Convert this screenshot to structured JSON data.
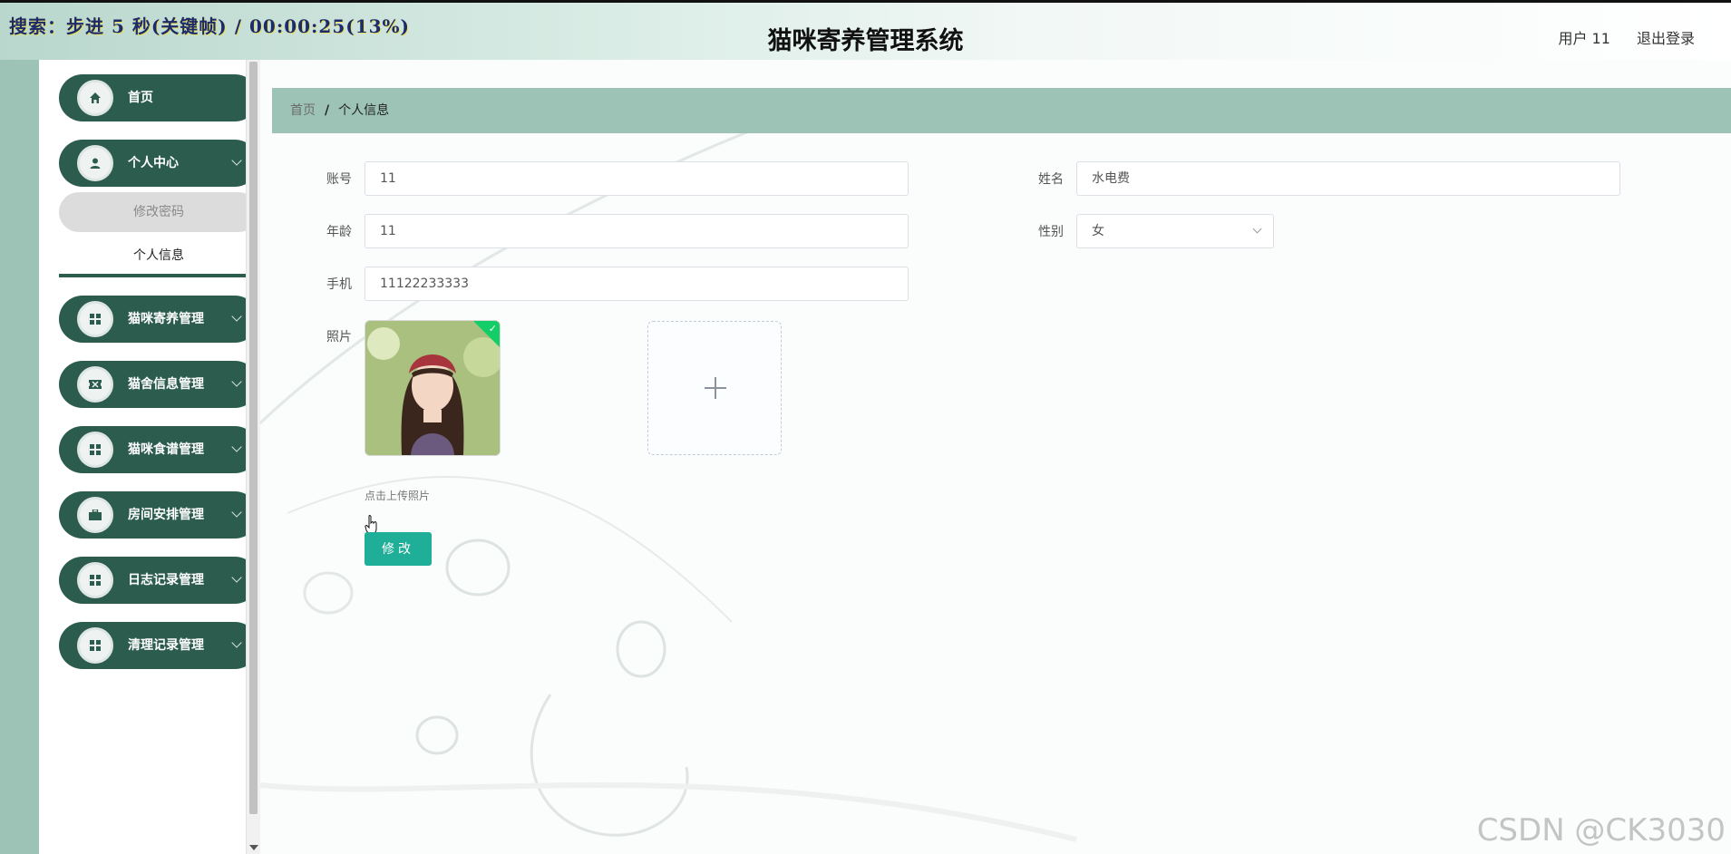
{
  "recording_overlay": "搜索：步进 5 秒(关键帧) / 00:00:25(13%)",
  "header": {
    "title": "猫咪寄养管理系统",
    "user_label": "用户 11",
    "logout_label": "退出登录"
  },
  "sidebar": {
    "items": [
      {
        "label": "首页",
        "icon": "home-icon"
      },
      {
        "label": "个人中心",
        "icon": "user-icon",
        "expanded": true,
        "children": [
          {
            "label": "修改密码",
            "active": false
          },
          {
            "label": "个人信息",
            "active": true
          }
        ]
      },
      {
        "label": "猫咪寄养管理",
        "icon": "grid-icon"
      },
      {
        "label": "猫舍信息管理",
        "icon": "ticket-icon"
      },
      {
        "label": "猫咪食谱管理",
        "icon": "grid-icon"
      },
      {
        "label": "房间安排管理",
        "icon": "briefcase-icon"
      },
      {
        "label": "日志记录管理",
        "icon": "grid-icon"
      },
      {
        "label": "清理记录管理",
        "icon": "grid-icon"
      }
    ]
  },
  "breadcrumb": {
    "home": "首页",
    "separator": "/",
    "current": "个人信息"
  },
  "form": {
    "account": {
      "label": "账号",
      "value": "11"
    },
    "name": {
      "label": "姓名",
      "value": "水电费"
    },
    "age": {
      "label": "年龄",
      "value": "11"
    },
    "gender": {
      "label": "性别",
      "value": "女"
    },
    "phone": {
      "label": "手机",
      "value": "11122233333"
    },
    "photo": {
      "label": "照片",
      "tip": "点击上传照片"
    },
    "submit_label": "修改"
  },
  "watermark": "CSDN @CK3030",
  "colors": {
    "sidebar_item": "#2b5c4e",
    "breadcrumb_bg": "#9cc3b6",
    "button": "#1fae97",
    "success_badge": "#13ce66"
  }
}
